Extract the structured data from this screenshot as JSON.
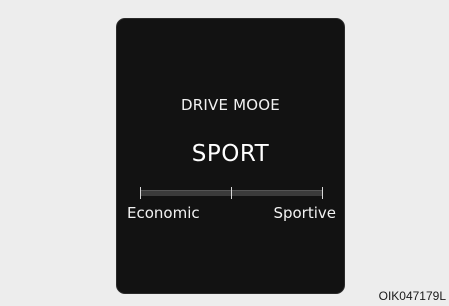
{
  "display": {
    "title": "DRIVE MOOE",
    "mode": "SPORT",
    "scale_left_label": "Economic",
    "scale_right_label": "Sportive"
  },
  "footer": {
    "code": "OIK047179L"
  },
  "colors": {
    "background": "#ededed",
    "screen": "#121212",
    "text": "#f2f2f2"
  }
}
